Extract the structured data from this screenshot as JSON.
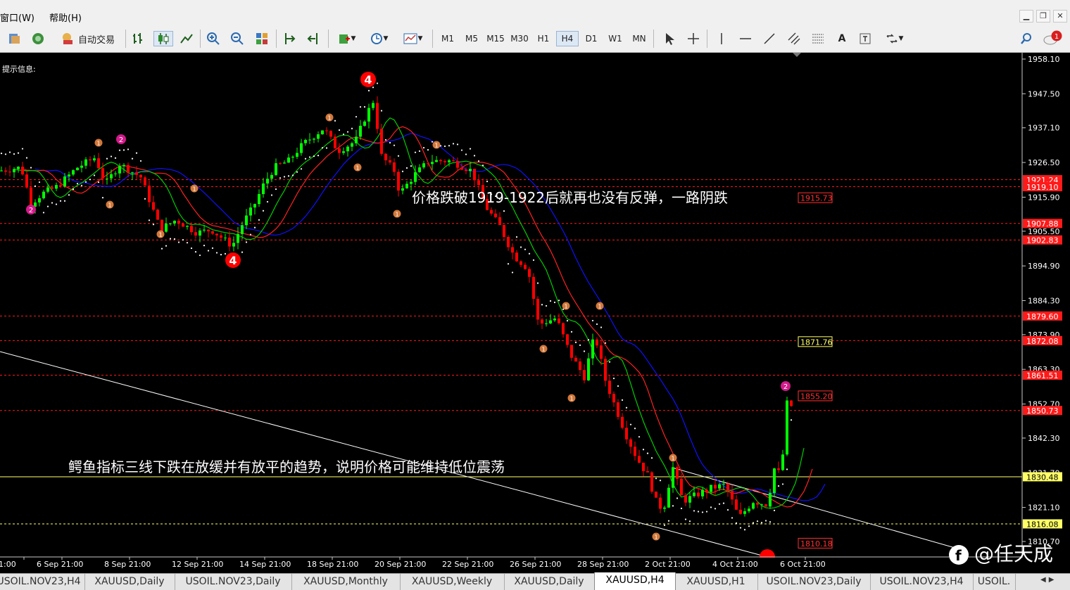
{
  "menu": {
    "window": "窗口(W)",
    "help": "帮助(H)"
  },
  "toolbar": {
    "auto_trade": "自动交易",
    "timeframes": [
      "M1",
      "M5",
      "M15",
      "M30",
      "H1",
      "H4",
      "D1",
      "W1",
      "MN"
    ],
    "selected_timeframe": "H4",
    "notification_count": "1"
  },
  "chart": {
    "info_label": "提示信息:",
    "price_axis": [
      "1958.10",
      "1947.50",
      "1937.10",
      "1926.50",
      "1915.90",
      "1905.50",
      "1894.90",
      "1884.30",
      "1873.90",
      "1863.30",
      "1852.70",
      "1842.30",
      "1831.70",
      "1821.10",
      "1810.70"
    ],
    "time_axis": [
      "1:00",
      "6 Sep 21:00",
      "8 Sep 21:00",
      "12 Sep 21:00",
      "14 Sep 21:00",
      "18 Sep 21:00",
      "20 Sep 21:00",
      "22 Sep 21:00",
      "26 Sep 21:00",
      "28 Sep 21:00",
      "2 Oct 21:00",
      "4 Oct 21:00",
      "6 Oct 21:00"
    ],
    "level_tags": [
      {
        "value": "1921.24",
        "color": "#ff1a1a"
      },
      {
        "value": "1919.10",
        "color": "#ff1a1a"
      },
      {
        "value": "1907.88",
        "color": "#ff1a1a"
      },
      {
        "value": "1902.83",
        "color": "#ff1a1a"
      },
      {
        "value": "1879.60",
        "color": "#ff1a1a"
      },
      {
        "value": "1872.08",
        "color": "#ff1a1a"
      },
      {
        "value": "1861.51",
        "color": "#ff1a1a"
      },
      {
        "value": "1850.73",
        "color": "#ff1a1a"
      },
      {
        "value": "1830.48",
        "color": "#ffff66"
      },
      {
        "value": "1816.08",
        "color": "#ffff66"
      }
    ],
    "floating_tags": [
      {
        "value": "1915.73",
        "color": "#ff3030"
      },
      {
        "value": "1871.76",
        "color": "#ffff66"
      },
      {
        "value": "1855.20",
        "color": "#ff3030"
      },
      {
        "value": "1810.18",
        "color": "#ff3030"
      }
    ],
    "annotation_top": "价格跌破1919-1922后就再也没有反弹，一路阴跌",
    "annotation_bottom": "鳄鱼指标三线下跌在放缓并有放平的趋势，说明价格可能维持低位震荡",
    "watermark": "@任天成",
    "wave_markers": [
      "4",
      "4",
      "2",
      "2",
      "1",
      "2"
    ]
  },
  "tabs": [
    "USOIL.NOV23,H4",
    "XAUUSD,Daily",
    "USOIL.NOV23,Daily",
    "XAUUSD,Monthly",
    "XAUUSD,Weekly",
    "XAUUSD,Daily",
    "XAUUSD,H4",
    "XAUUSD,H1",
    "USOIL.NOV23,Daily",
    "USOIL.NOV23,H4",
    "USOIL."
  ],
  "active_tab": "XAUUSD,H4",
  "colors": {
    "bull": "#00ff00",
    "bear": "#ff0000",
    "jaw": "#1010ff",
    "teeth": "#ff2020",
    "lips": "#00cc00",
    "grid_red": "#ff2a2a",
    "grid_yellow": "#ffff66"
  }
}
